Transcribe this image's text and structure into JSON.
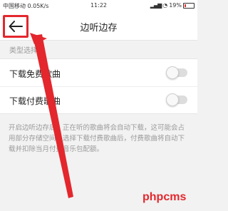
{
  "statusbar": {
    "left": "中国移动 0.05K/s",
    "time": "11:22",
    "battery": "19%"
  },
  "header": {
    "title": "边听边存",
    "back_icon": "back-arrow-icon"
  },
  "section": {
    "label": "类型选择"
  },
  "rows": [
    {
      "label": "下载免费歌曲",
      "enabled": false
    },
    {
      "label": "下载付费歌曲",
      "enabled": false
    }
  ],
  "description": "开启边听边存后，正在听的歌曲将会自动下载，这可能会占用部分存储空间。选择下载付费歌曲后，付费歌曲将自动下载并扣除当月付费音乐包配额。",
  "annotation": {
    "color": "#e3272d"
  },
  "watermark": "phpcms"
}
